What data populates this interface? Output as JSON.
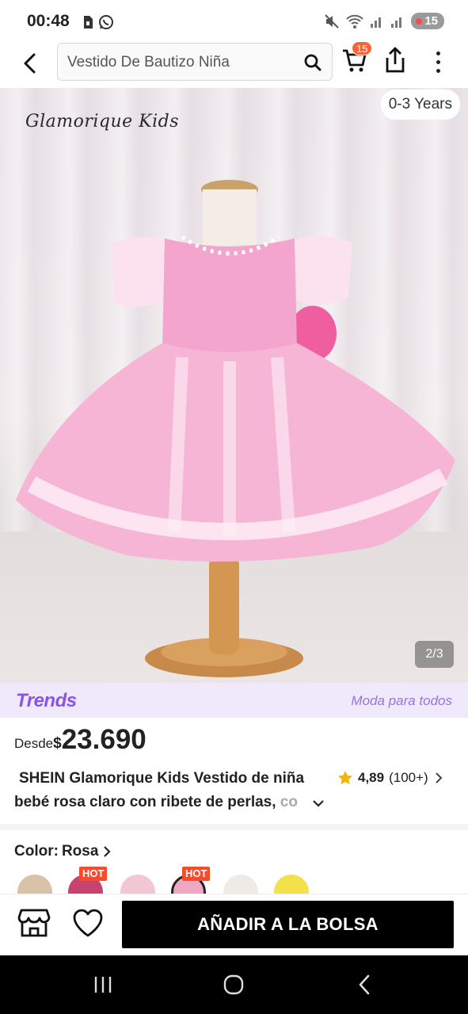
{
  "status_bar": {
    "time": "00:48",
    "battery": "15",
    "icons": [
      "sim-icon",
      "whatsapp-icon",
      "mute-icon",
      "wifi-icon",
      "signal-icon",
      "signal-icon",
      "battery-icon"
    ]
  },
  "nav": {
    "search_text": "Vestido De Bautizo Niña",
    "cart_count": "15"
  },
  "hero": {
    "brand": "Glamorique  Kids",
    "age_chip": "0-3 Years",
    "page_counter": "2/3"
  },
  "trends": {
    "logo": "Trends",
    "tagline": "Moda para todos"
  },
  "price": {
    "prefix": "Desde",
    "currency": "$",
    "value": "23.690"
  },
  "product": {
    "title_line1": "SHEIN Glamorique Kids Vestido de niña",
    "title_line2": "bebé rosa claro con ribete de perlas,",
    "title_fade": " co",
    "rating": "4,89",
    "rating_count": "(100+)"
  },
  "color": {
    "label": "Color:",
    "value": "Rosa",
    "swatches": [
      {
        "name": "beige",
        "hot": false,
        "color": "#d8c2a8"
      },
      {
        "name": "magenta-rose",
        "hot": true,
        "color": "#c8426e"
      },
      {
        "name": "light-pink",
        "hot": false,
        "color": "#f2c6d2"
      },
      {
        "name": "pink",
        "hot": true,
        "color": "#f0a8c2"
      },
      {
        "name": "white",
        "hot": false,
        "color": "#efeae6"
      },
      {
        "name": "yellow",
        "hot": false,
        "color": "#f2e14a"
      }
    ],
    "hot_label": "HOT"
  },
  "actions": {
    "add_to_bag": "AÑADIR A LA BOLSA"
  },
  "colors": {
    "accent_orange": "#fa6338",
    "trends_purple": "#8a55e6",
    "star": "#f7b500"
  }
}
